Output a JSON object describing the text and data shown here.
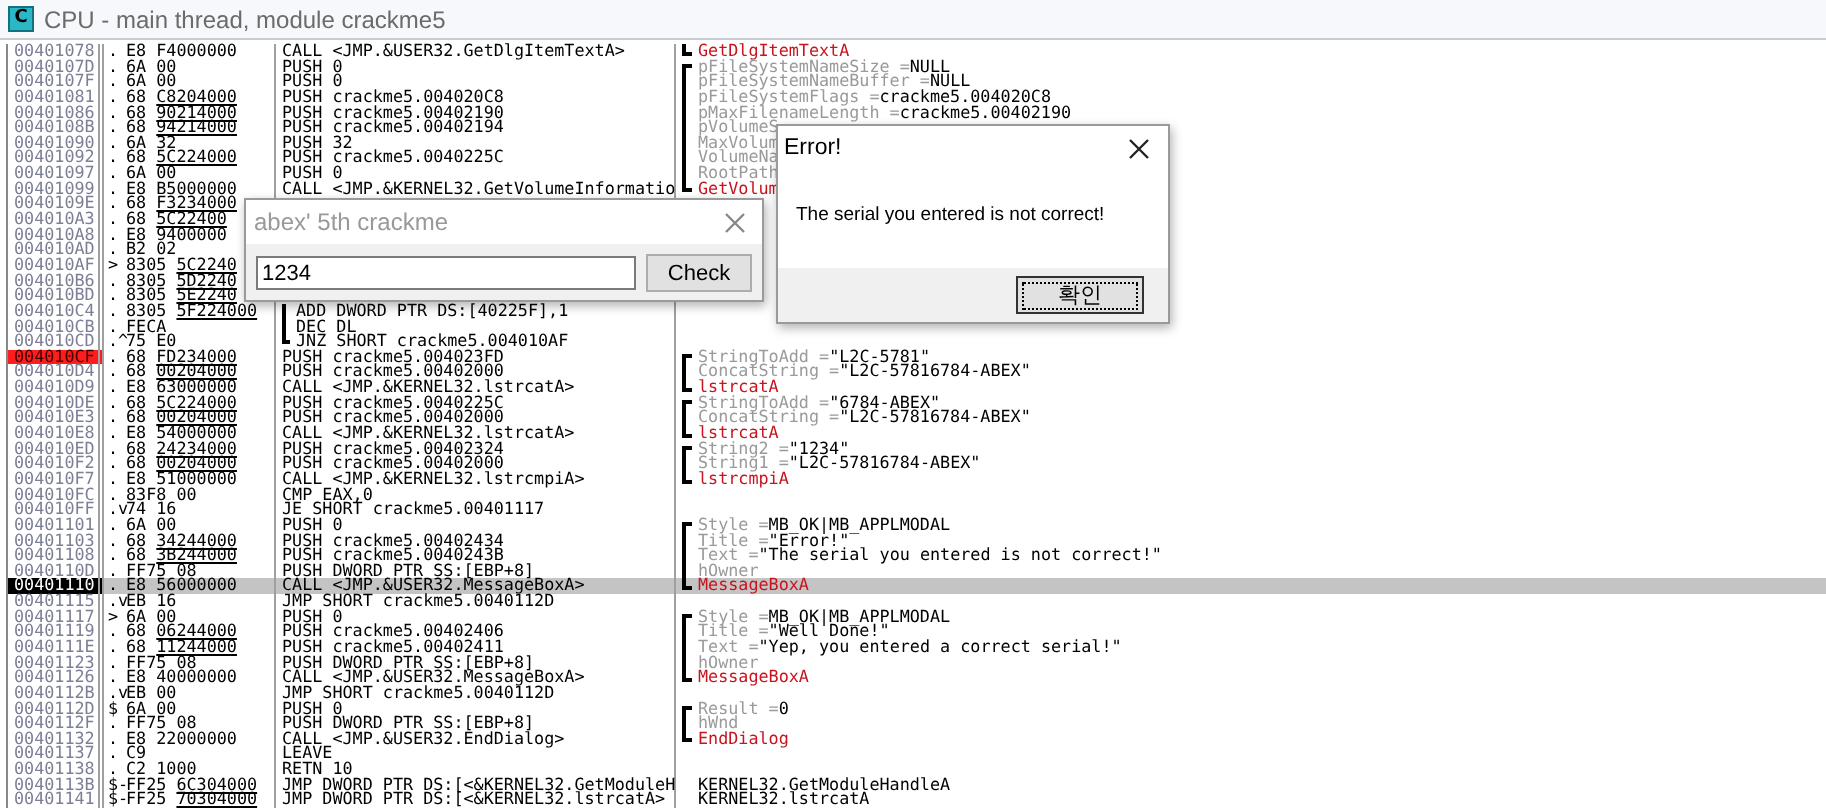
{
  "window": {
    "icon_letter": "C",
    "title": "CPU - main thread, module crackme5"
  },
  "rows": [
    {
      "address": "00401078",
      "mark": ".",
      "opcode": "E8",
      "operand": "F4000000",
      "fixup": false,
      "disasm": "CALL <JMP.&USER32.GetDlgItemTextA>",
      "comment": {
        "kind": "call",
        "text": "GetDlgItemTextA",
        "bracket_top": false,
        "bracket_end": true
      },
      "selected": false,
      "breakpoint": false
    },
    {
      "address": "0040107D",
      "mark": ".",
      "opcode": "6A",
      "operand": "00",
      "fixup": false,
      "disasm": "PUSH 0",
      "comment": {
        "kind": "param",
        "name": "pFileSystemNameSize =",
        "value": "NULL",
        "bracket_top": true,
        "bracket_end": false
      },
      "selected": false,
      "breakpoint": false
    },
    {
      "address": "0040107F",
      "mark": ".",
      "opcode": "6A",
      "operand": "00",
      "fixup": false,
      "disasm": "PUSH 0",
      "comment": {
        "kind": "param",
        "name": "pFileSystemNameBuffer =",
        "value": "NULL",
        "bracket_top": false,
        "bracket_end": false
      },
      "selected": false,
      "breakpoint": false
    },
    {
      "address": "00401081",
      "mark": ".",
      "opcode": "68",
      "operand": "C8204000",
      "fixup": true,
      "disasm": "PUSH crackme5.004020C8",
      "comment": {
        "kind": "param",
        "name": "pFileSystemFlags =",
        "value": "crackme5.004020C8",
        "bracket_top": false,
        "bracket_end": false
      },
      "selected": false,
      "breakpoint": false
    },
    {
      "address": "00401086",
      "mark": ".",
      "opcode": "68",
      "operand": "90214000",
      "fixup": true,
      "disasm": "PUSH crackme5.00402190",
      "comment": {
        "kind": "param",
        "name": "pMaxFilenameLength =",
        "value": "crackme5.00402190",
        "bracket_top": false,
        "bracket_end": false
      },
      "selected": false,
      "breakpoint": false
    },
    {
      "address": "0040108B",
      "mark": ".",
      "opcode": "68",
      "operand": "94214000",
      "fixup": true,
      "disasm": "PUSH crackme5.00402194",
      "comment": {
        "kind": "param",
        "name": "pVolumeS",
        "bracket_top": false,
        "bracket_end": false
      },
      "selected": false,
      "breakpoint": false
    },
    {
      "address": "00401090",
      "mark": ".",
      "opcode": "6A",
      "operand": "32",
      "fixup": false,
      "disasm": "PUSH 32",
      "comment": {
        "kind": "param",
        "name": "MaxVolum",
        "bracket_top": false,
        "bracket_end": false
      },
      "selected": false,
      "breakpoint": false
    },
    {
      "address": "00401092",
      "mark": ".",
      "opcode": "68",
      "operand": "5C224000",
      "fixup": true,
      "disasm": "PUSH crackme5.0040225C",
      "comment": {
        "kind": "param",
        "name": "VolumeNa",
        "bracket_top": false,
        "bracket_end": false
      },
      "selected": false,
      "breakpoint": false
    },
    {
      "address": "00401097",
      "mark": ".",
      "opcode": "6A",
      "operand": "00",
      "fixup": false,
      "disasm": "PUSH 0",
      "comment": {
        "kind": "param",
        "name": "RootPath",
        "bracket_top": false,
        "bracket_end": false
      },
      "selected": false,
      "breakpoint": false
    },
    {
      "address": "00401099",
      "mark": ".",
      "opcode": "E8",
      "operand": "B5000000",
      "fixup": false,
      "disasm": "CALL <JMP.&KERNEL32.GetVolumeInformatio",
      "comment": {
        "kind": "call",
        "text": "GetVolum",
        "bracket_top": false,
        "bracket_end": true
      },
      "selected": false,
      "breakpoint": false
    },
    {
      "address": "0040109E",
      "mark": ".",
      "opcode": "68",
      "operand": "F3234000",
      "fixup": true,
      "selected": false,
      "breakpoint": false
    },
    {
      "address": "004010A3",
      "mark": ".",
      "opcode": "68",
      "operand": "5C22400",
      "fixup": true,
      "selected": false,
      "breakpoint": false
    },
    {
      "address": "004010A8",
      "mark": ".",
      "opcode": "E8",
      "operand": "9400000",
      "fixup": false,
      "selected": false,
      "breakpoint": false
    },
    {
      "address": "004010AD",
      "mark": ".",
      "opcode": "B2",
      "operand": "02",
      "fixup": false,
      "selected": false,
      "breakpoint": false
    },
    {
      "address": "004010AF",
      "mark": ">",
      "opcode": "8305",
      "operand": "5C2240",
      "fixup": true,
      "selected": false,
      "breakpoint": false
    },
    {
      "address": "004010B6",
      "mark": ".",
      "opcode": "8305",
      "operand": "5D2240",
      "fixup": true,
      "selected": false,
      "breakpoint": false
    },
    {
      "address": "004010BD",
      "mark": ".",
      "opcode": "8305",
      "operand": "5E2240",
      "fixup": true,
      "selected": false,
      "breakpoint": false
    },
    {
      "address": "004010C4",
      "mark": ".",
      "opcode": "8305",
      "operand": "5F224000",
      "fixup": true,
      "disasm": "ADD DWORD PTR DS:[40225F],1",
      "loop_end": false,
      "selected": false,
      "breakpoint": false
    },
    {
      "address": "004010CB",
      "mark": ".",
      "opcode": "FECA",
      "disasm": "DEC DL",
      "loop_end": false,
      "selected": false,
      "breakpoint": false
    },
    {
      "address": "004010CD",
      "mark": ".^",
      "opcode": "75",
      "operand": "E0",
      "fixup": false,
      "disasm": "JNZ SHORT crackme5.004010AF",
      "loop_end": true,
      "selected": false,
      "breakpoint": false
    },
    {
      "address": "004010CF",
      "mark": ".",
      "opcode": "68",
      "operand": "FD234000",
      "fixup": true,
      "disasm": "PUSH crackme5.004023FD",
      "comment": {
        "kind": "param",
        "name": "StringToAdd =",
        "value": "\"L2C-5781\"",
        "bracket_top": true,
        "bracket_end": false
      },
      "selected": false,
      "breakpoint": true
    },
    {
      "address": "004010D4",
      "mark": ".",
      "opcode": "68",
      "operand": "00204000",
      "fixup": true,
      "disasm": "PUSH crackme5.00402000",
      "comment": {
        "kind": "param",
        "name": "ConcatString =",
        "value": "\"L2C-57816784-ABEX\"",
        "bracket_top": false,
        "bracket_end": false
      },
      "selected": false,
      "breakpoint": false
    },
    {
      "address": "004010D9",
      "mark": ".",
      "opcode": "E8",
      "operand": "63000000",
      "fixup": false,
      "disasm": "CALL <JMP.&KERNEL32.lstrcatA>",
      "comment": {
        "kind": "call",
        "text": "lstrcatA",
        "bracket_top": false,
        "bracket_end": true
      },
      "selected": false,
      "breakpoint": false
    },
    {
      "address": "004010DE",
      "mark": ".",
      "opcode": "68",
      "operand": "5C224000",
      "fixup": true,
      "disasm": "PUSH crackme5.0040225C",
      "comment": {
        "kind": "param",
        "name": "StringToAdd =",
        "value": "\"6784-ABEX\"",
        "bracket_top": true,
        "bracket_end": false
      },
      "selected": false,
      "breakpoint": false
    },
    {
      "address": "004010E3",
      "mark": ".",
      "opcode": "68",
      "operand": "00204000",
      "fixup": true,
      "disasm": "PUSH crackme5.00402000",
      "comment": {
        "kind": "param",
        "name": "ConcatString =",
        "value": "\"L2C-57816784-ABEX\"",
        "bracket_top": false,
        "bracket_end": false
      },
      "selected": false,
      "breakpoint": false
    },
    {
      "address": "004010E8",
      "mark": ".",
      "opcode": "E8",
      "operand": "54000000",
      "fixup": false,
      "disasm": "CALL <JMP.&KERNEL32.lstrcatA>",
      "comment": {
        "kind": "call",
        "text": "lstrcatA",
        "bracket_top": false,
        "bracket_end": true
      },
      "selected": false,
      "breakpoint": false
    },
    {
      "address": "004010ED",
      "mark": ".",
      "opcode": "68",
      "operand": "24234000",
      "fixup": true,
      "disasm": "PUSH crackme5.00402324",
      "comment": {
        "kind": "param",
        "name": "String2 =",
        "value": "\"1234\"",
        "bracket_top": true,
        "bracket_end": false
      },
      "selected": false,
      "breakpoint": false
    },
    {
      "address": "004010F2",
      "mark": ".",
      "opcode": "68",
      "operand": "00204000",
      "fixup": true,
      "disasm": "PUSH crackme5.00402000",
      "comment": {
        "kind": "param",
        "name": "String1 =",
        "value": "\"L2C-57816784-ABEX\"",
        "bracket_top": false,
        "bracket_end": false
      },
      "selected": false,
      "breakpoint": false
    },
    {
      "address": "004010F7",
      "mark": ".",
      "opcode": "E8",
      "operand": "51000000",
      "fixup": false,
      "disasm": "CALL <JMP.&KERNEL32.lstrcmpiA>",
      "comment": {
        "kind": "call",
        "text": "lstrcmpiA",
        "bracket_top": false,
        "bracket_end": true
      },
      "selected": false,
      "breakpoint": false
    },
    {
      "address": "004010FC",
      "mark": ".",
      "opcode": "83F8",
      "operand": "00",
      "fixup": false,
      "disasm": "CMP EAX,0",
      "selected": false,
      "breakpoint": false
    },
    {
      "address": "004010FF",
      "mark": ".v",
      "opcode": "74",
      "operand": "16",
      "fixup": false,
      "disasm": "JE SHORT crackme5.00401117",
      "selected": false,
      "breakpoint": false
    },
    {
      "address": "00401101",
      "mark": ".",
      "opcode": "6A",
      "operand": "00",
      "fixup": false,
      "disasm": "PUSH 0",
      "comment": {
        "kind": "param",
        "name": "Style =",
        "value": "MB_OK|MB_APPLMODAL",
        "bracket_top": true,
        "bracket_end": false
      },
      "selected": false,
      "breakpoint": false
    },
    {
      "address": "00401103",
      "mark": ".",
      "opcode": "68",
      "operand": "34244000",
      "fixup": true,
      "disasm": "PUSH crackme5.00402434",
      "comment": {
        "kind": "param",
        "name": "Title =",
        "value": "\"Error!\"",
        "bracket_top": false,
        "bracket_end": false
      },
      "selected": false,
      "breakpoint": false
    },
    {
      "address": "00401108",
      "mark": ".",
      "opcode": "68",
      "operand": "3B244000",
      "fixup": true,
      "disasm": "PUSH crackme5.0040243B",
      "comment": {
        "kind": "param",
        "name": "Text =",
        "value": "\"The serial you entered is not correct!\"",
        "bracket_top": false,
        "bracket_end": false
      },
      "selected": false,
      "breakpoint": false
    },
    {
      "address": "0040110D",
      "mark": ".",
      "opcode": "FF75",
      "operand": "08",
      "fixup": false,
      "disasm": "PUSH DWORD PTR SS:[EBP+8]",
      "comment": {
        "kind": "param",
        "name": "hOwner",
        "bracket_top": false,
        "bracket_end": false
      },
      "selected": false,
      "breakpoint": false
    },
    {
      "address": "00401110",
      "mark": ".",
      "opcode": "E8",
      "operand": "56000000",
      "fixup": false,
      "disasm": "CALL <JMP.&USER32.MessageBoxA>",
      "comment": {
        "kind": "call",
        "text": "MessageBoxA",
        "bracket_top": false,
        "bracket_end": true
      },
      "selected": true,
      "breakpoint": false
    },
    {
      "address": "00401115",
      "mark": ".v",
      "opcode": "EB",
      "operand": "16",
      "fixup": false,
      "disasm": "JMP SHORT crackme5.0040112D",
      "selected": false,
      "breakpoint": false
    },
    {
      "address": "00401117",
      "mark": ">",
      "opcode": "6A",
      "operand": "00",
      "fixup": false,
      "disasm": "PUSH 0",
      "comment": {
        "kind": "param",
        "name": "Style =",
        "value": "MB_OK|MB_APPLMODAL",
        "bracket_top": true,
        "bracket_end": false
      },
      "selected": false,
      "breakpoint": false
    },
    {
      "address": "00401119",
      "mark": ".",
      "opcode": "68",
      "operand": "06244000",
      "fixup": true,
      "disasm": "PUSH crackme5.00402406",
      "comment": {
        "kind": "param",
        "name": "Title =",
        "value": "\"Well Done!\"",
        "bracket_top": false,
        "bracket_end": false
      },
      "selected": false,
      "breakpoint": false
    },
    {
      "address": "0040111E",
      "mark": ".",
      "opcode": "68",
      "operand": "11244000",
      "fixup": true,
      "disasm": "PUSH crackme5.00402411",
      "comment": {
        "kind": "param",
        "name": "Text =",
        "value": "\"Yep, you entered a correct serial!\"",
        "bracket_top": false,
        "bracket_end": false
      },
      "selected": false,
      "breakpoint": false
    },
    {
      "address": "00401123",
      "mark": ".",
      "opcode": "FF75",
      "operand": "08",
      "fixup": false,
      "disasm": "PUSH DWORD PTR SS:[EBP+8]",
      "comment": {
        "kind": "param",
        "name": "hOwner",
        "bracket_top": false,
        "bracket_end": false
      },
      "selected": false,
      "breakpoint": false
    },
    {
      "address": "00401126",
      "mark": ".",
      "opcode": "E8",
      "operand": "40000000",
      "fixup": false,
      "disasm": "CALL <JMP.&USER32.MessageBoxA>",
      "comment": {
        "kind": "call",
        "text": "MessageBoxA",
        "bracket_top": false,
        "bracket_end": true
      },
      "selected": false,
      "breakpoint": false
    },
    {
      "address": "0040112B",
      "mark": ".v",
      "opcode": "EB",
      "operand": "00",
      "fixup": false,
      "disasm": "JMP SHORT crackme5.0040112D",
      "selected": false,
      "breakpoint": false
    },
    {
      "address": "0040112D",
      "mark": "$",
      "opcode": "6A",
      "operand": "00",
      "fixup": false,
      "disasm": "PUSH 0",
      "comment": {
        "kind": "param",
        "name": "Result =",
        "value": "0",
        "bracket_top": true,
        "bracket_end": false
      },
      "selected": false,
      "breakpoint": false
    },
    {
      "address": "0040112F",
      "mark": ".",
      "opcode": "FF75",
      "operand": "08",
      "fixup": false,
      "disasm": "PUSH DWORD PTR SS:[EBP+8]",
      "comment": {
        "kind": "param",
        "name": "hWnd",
        "bracket_top": false,
        "bracket_end": false
      },
      "selected": false,
      "breakpoint": false
    },
    {
      "address": "00401132",
      "mark": ".",
      "opcode": "E8",
      "operand": "22000000",
      "fixup": false,
      "disasm": "CALL <JMP.&USER32.EndDialog>",
      "comment": {
        "kind": "call",
        "text": "EndDialog",
        "bracket_top": false,
        "bracket_end": true
      },
      "selected": false,
      "breakpoint": false
    },
    {
      "address": "00401137",
      "mark": ".",
      "opcode": "C9",
      "disasm": "LEAVE",
      "selected": false,
      "breakpoint": false
    },
    {
      "address": "00401138",
      "mark": ".",
      "opcode": "C2",
      "operand": "1000",
      "fixup": false,
      "disasm": "RETN 10",
      "selected": false,
      "breakpoint": false
    },
    {
      "address": "0040113B",
      "mark": "$-",
      "opcode": "FF25",
      "operand": "6C304000",
      "fixup": true,
      "disasm": "JMP DWORD PTR DS:[<&KERNEL32.GetModuleH",
      "comment": {
        "kind": "plain",
        "text": "KERNEL32.GetModuleHandleA"
      },
      "selected": false,
      "breakpoint": false
    },
    {
      "address": "00401141",
      "mark": "$-",
      "opcode": "FF25",
      "operand": "70304000",
      "fixup": true,
      "disasm": "JMP DWORD PTR DS:[<&KERNEL32.lstrcatA>",
      "comment": {
        "kind": "plain",
        "text": "KERNEL32.lstrcatA"
      },
      "selected": false,
      "breakpoint": false
    }
  ],
  "crackme_dialog": {
    "title": "abex' 5th crackme",
    "serial_value": "1234",
    "button": "Check"
  },
  "error_dialog": {
    "title": "Error!",
    "message": "The serial you entered is not correct!",
    "button": "확인"
  }
}
